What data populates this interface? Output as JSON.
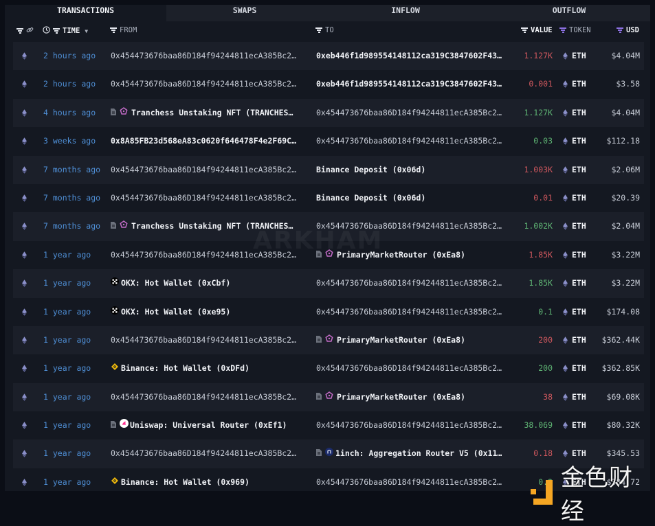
{
  "tabs": [
    {
      "label": "TRANSACTIONS",
      "active": true
    },
    {
      "label": "SWAPS",
      "active": false
    },
    {
      "label": "INFLOW",
      "active": false
    },
    {
      "label": "OUTFLOW",
      "active": false
    }
  ],
  "columns": {
    "time": "TIME",
    "from": "FROM",
    "to": "TO",
    "value": "VALUE",
    "token": "TOKEN",
    "usd": "USD"
  },
  "colors": {
    "accent_purple": "#8b6fe0",
    "time_blue": "#4f8fd6",
    "outflow_red": "#d0585e",
    "inflow_green": "#5fb574"
  },
  "rows": [
    {
      "time": "2 hours ago",
      "from": {
        "text": "0x454473676baa86D184f94244811ecA385Bc2…",
        "kind": "addr"
      },
      "to": {
        "text": "0xeb446f1d989554148112ca319C3847602F43…",
        "kind": "ent"
      },
      "value": "1.127K",
      "dir": "out",
      "token": "ETH",
      "usd": "$4.04M"
    },
    {
      "time": "2 hours ago",
      "from": {
        "text": "0x454473676baa86D184f94244811ecA385Bc2…",
        "kind": "addr"
      },
      "to": {
        "text": "0xeb446f1d989554148112ca319C3847602F43…",
        "kind": "ent"
      },
      "value": "0.001",
      "dir": "out",
      "token": "ETH",
      "usd": "$3.58"
    },
    {
      "time": "4 hours ago",
      "from": {
        "text": "Tranchess Unstaking NFT (TRANCHES…",
        "kind": "ent",
        "icon": "contract-tranchess"
      },
      "to": {
        "text": "0x454473676baa86D184f94244811ecA385Bc2…",
        "kind": "addr"
      },
      "value": "1.127K",
      "dir": "in",
      "token": "ETH",
      "usd": "$4.04M"
    },
    {
      "time": "3 weeks ago",
      "from": {
        "text": "0x8A85FB23d568eA83c0620f646478F4e2F69C…",
        "kind": "ent"
      },
      "to": {
        "text": "0x454473676baa86D184f94244811ecA385Bc2…",
        "kind": "addr"
      },
      "value": "0.03",
      "dir": "in",
      "token": "ETH",
      "usd": "$112.18"
    },
    {
      "time": "7 months ago",
      "from": {
        "text": "0x454473676baa86D184f94244811ecA385Bc2…",
        "kind": "addr"
      },
      "to": {
        "text": "Binance Deposit (0x06d)",
        "kind": "ent"
      },
      "value": "1.003K",
      "dir": "out",
      "token": "ETH",
      "usd": "$2.06M"
    },
    {
      "time": "7 months ago",
      "from": {
        "text": "0x454473676baa86D184f94244811ecA385Bc2…",
        "kind": "addr"
      },
      "to": {
        "text": "Binance Deposit (0x06d)",
        "kind": "ent"
      },
      "value": "0.01",
      "dir": "out",
      "token": "ETH",
      "usd": "$20.39"
    },
    {
      "time": "7 months ago",
      "from": {
        "text": "Tranchess Unstaking NFT (TRANCHES…",
        "kind": "ent",
        "icon": "contract-tranchess"
      },
      "to": {
        "text": "0x454473676baa86D184f94244811ecA385Bc2…",
        "kind": "addr"
      },
      "value": "1.002K",
      "dir": "in",
      "token": "ETH",
      "usd": "$2.04M"
    },
    {
      "time": "1 year ago",
      "from": {
        "text": "0x454473676baa86D184f94244811ecA385Bc2…",
        "kind": "addr"
      },
      "to": {
        "text": "PrimaryMarketRouter (0xEa8)",
        "kind": "ent",
        "icon": "contract-tranchess"
      },
      "value": "1.85K",
      "dir": "out",
      "token": "ETH",
      "usd": "$3.22M"
    },
    {
      "time": "1 year ago",
      "from": {
        "text": "OKX: Hot Wallet (0xCbf)",
        "kind": "ent",
        "icon": "okx"
      },
      "to": {
        "text": "0x454473676baa86D184f94244811ecA385Bc2…",
        "kind": "addr"
      },
      "value": "1.85K",
      "dir": "in",
      "token": "ETH",
      "usd": "$3.22M"
    },
    {
      "time": "1 year ago",
      "from": {
        "text": "OKX: Hot Wallet (0xe95)",
        "kind": "ent",
        "icon": "okx"
      },
      "to": {
        "text": "0x454473676baa86D184f94244811ecA385Bc2…",
        "kind": "addr"
      },
      "value": "0.1",
      "dir": "in",
      "token": "ETH",
      "usd": "$174.08"
    },
    {
      "time": "1 year ago",
      "from": {
        "text": "0x454473676baa86D184f94244811ecA385Bc2…",
        "kind": "addr"
      },
      "to": {
        "text": "PrimaryMarketRouter (0xEa8)",
        "kind": "ent",
        "icon": "contract-tranchess"
      },
      "value": "200",
      "dir": "out",
      "token": "ETH",
      "usd": "$362.44K"
    },
    {
      "time": "1 year ago",
      "from": {
        "text": "Binance: Hot Wallet (0xDFd)",
        "kind": "ent",
        "icon": "binance"
      },
      "to": {
        "text": "0x454473676baa86D184f94244811ecA385Bc2…",
        "kind": "addr"
      },
      "value": "200",
      "dir": "in",
      "token": "ETH",
      "usd": "$362.85K"
    },
    {
      "time": "1 year ago",
      "from": {
        "text": "0x454473676baa86D184f94244811ecA385Bc2…",
        "kind": "addr"
      },
      "to": {
        "text": "PrimaryMarketRouter (0xEa8)",
        "kind": "ent",
        "icon": "contract-tranchess"
      },
      "value": "38",
      "dir": "out",
      "token": "ETH",
      "usd": "$69.08K"
    },
    {
      "time": "1 year ago",
      "from": {
        "text": "Uniswap: Universal Router (0xEf1)",
        "kind": "ent",
        "icon": "contract-uniswap"
      },
      "to": {
        "text": "0x454473676baa86D184f94244811ecA385Bc2…",
        "kind": "addr"
      },
      "value": "38.069",
      "dir": "in",
      "token": "ETH",
      "usd": "$80.32K"
    },
    {
      "time": "1 year ago",
      "from": {
        "text": "0x454473676baa86D184f94244811ecA385Bc2…",
        "kind": "addr"
      },
      "to": {
        "text": "1inch: Aggregation Router V5 (0x11…",
        "kind": "ent",
        "icon": "contract-1inch"
      },
      "value": "0.18",
      "dir": "out",
      "token": "ETH",
      "usd": "$345.53"
    },
    {
      "time": "1 year ago",
      "from": {
        "text": "Binance: Hot Wallet (0x969)",
        "kind": "ent",
        "icon": "binance"
      },
      "to": {
        "text": "0x454473676baa86D184f94244811ecA385Bc2…",
        "kind": "addr"
      },
      "value": "0.2",
      "dir": "in",
      "token": "ETH",
      "usd": "$384.72"
    }
  ],
  "watermark": "ARKHAM",
  "overlay_brand": "金色财经"
}
